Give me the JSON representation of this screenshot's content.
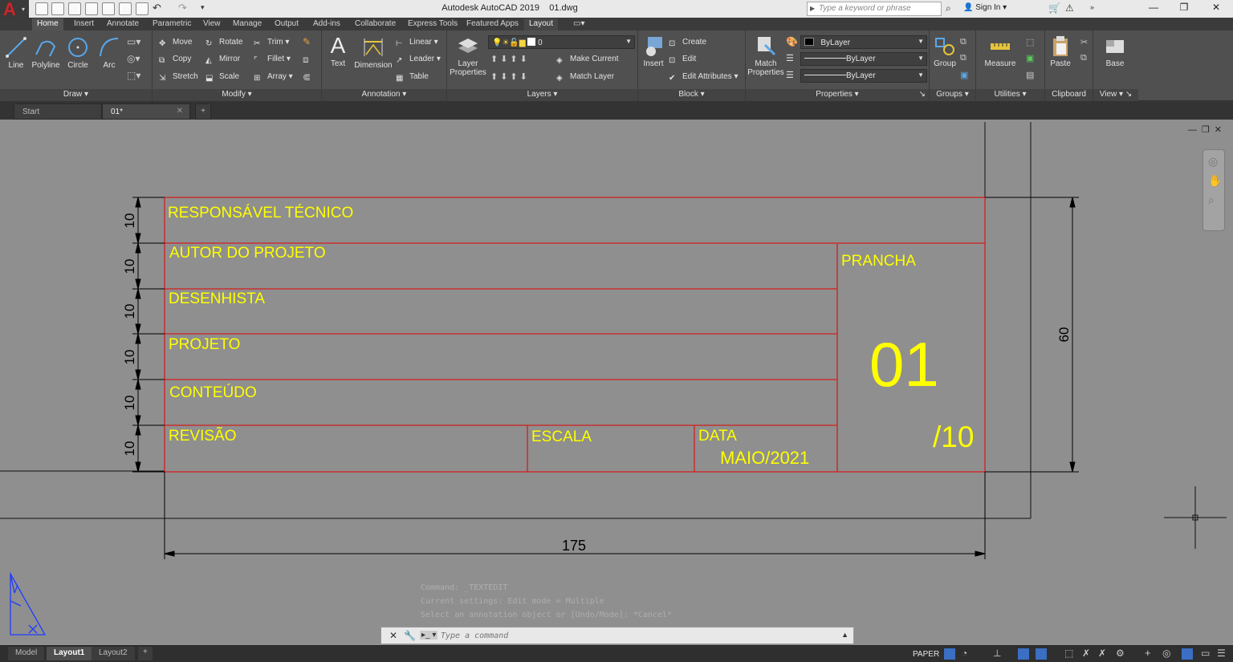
{
  "app": {
    "title": "Autodesk AutoCAD 2019",
    "filename": "01.dwg",
    "search_placeholder": "Type a keyword or phrase",
    "sign_in": "Sign In"
  },
  "ribbon_tabs": [
    "Home",
    "Insert",
    "Annotate",
    "Parametric",
    "View",
    "Manage",
    "Output",
    "Add-ins",
    "Collaborate",
    "Express Tools",
    "Featured Apps",
    "Layout"
  ],
  "draw_panel": {
    "title": "Draw",
    "tools": [
      "Line",
      "Polyline",
      "Circle",
      "Arc"
    ]
  },
  "modify_panel": {
    "title": "Modify",
    "tools": [
      "Move",
      "Rotate",
      "Trim",
      "Copy",
      "Mirror",
      "Fillet",
      "Stretch",
      "Scale",
      "Array"
    ]
  },
  "annotation_panel": {
    "title": "Annotation",
    "text": "Text",
    "dimension": "Dimension",
    "linear": "Linear",
    "leader": "Leader",
    "table": "Table"
  },
  "layers_panel": {
    "title": "Layers",
    "layer_properties": "Layer Properties",
    "current_layer": "0",
    "make_current": "Make Current",
    "match_layer": "Match Layer"
  },
  "block_panel": {
    "title": "Block",
    "insert": "Insert",
    "create": "Create",
    "edit": "Edit",
    "edit_attributes": "Edit Attributes"
  },
  "properties_panel": {
    "title": "Properties",
    "match_properties": "Match Properties",
    "color": "ByLayer",
    "linetype": "ByLayer",
    "lineweight": "ByLayer"
  },
  "groups_panel": {
    "title": "Groups",
    "group": "Group"
  },
  "utilities_panel": {
    "title": "Utilities",
    "measure": "Measure"
  },
  "clipboard_panel": {
    "title": "Clipboard",
    "paste": "Paste"
  },
  "view_panel": {
    "title": "View",
    "base": "Base"
  },
  "file_tabs": {
    "start": "Start",
    "doc": "01*"
  },
  "drawing": {
    "rows": [
      "RESPONSÁVEL TÉCNICO",
      "AUTOR DO PROJETO",
      "DESENHISTA",
      "PROJETO",
      "CONTEÚDO",
      "REVISÃO"
    ],
    "escala_label": "ESCALA",
    "data_label": "DATA",
    "data_value": "MAIO/2021",
    "prancha_label": "PRANCHA",
    "prancha_number": "01",
    "prancha_total": "/10",
    "row_dim": "10",
    "height_dim": "60",
    "width_dim": "175",
    "colors": {
      "text": "#ffff00",
      "frame": "#d21f1f",
      "dimension": "#000000",
      "ucs": "#1f3cff"
    }
  },
  "command": {
    "history": [
      "Command: _TEXTEDIT",
      "Current settings: Edit mode = Multiple",
      "Select an annotation object or [Undo/Mode]: *Cancel*"
    ],
    "placeholder": "Type a command"
  },
  "status": {
    "layout_tabs": [
      "Model",
      "Layout1",
      "Layout2"
    ],
    "paper": "PAPER"
  }
}
